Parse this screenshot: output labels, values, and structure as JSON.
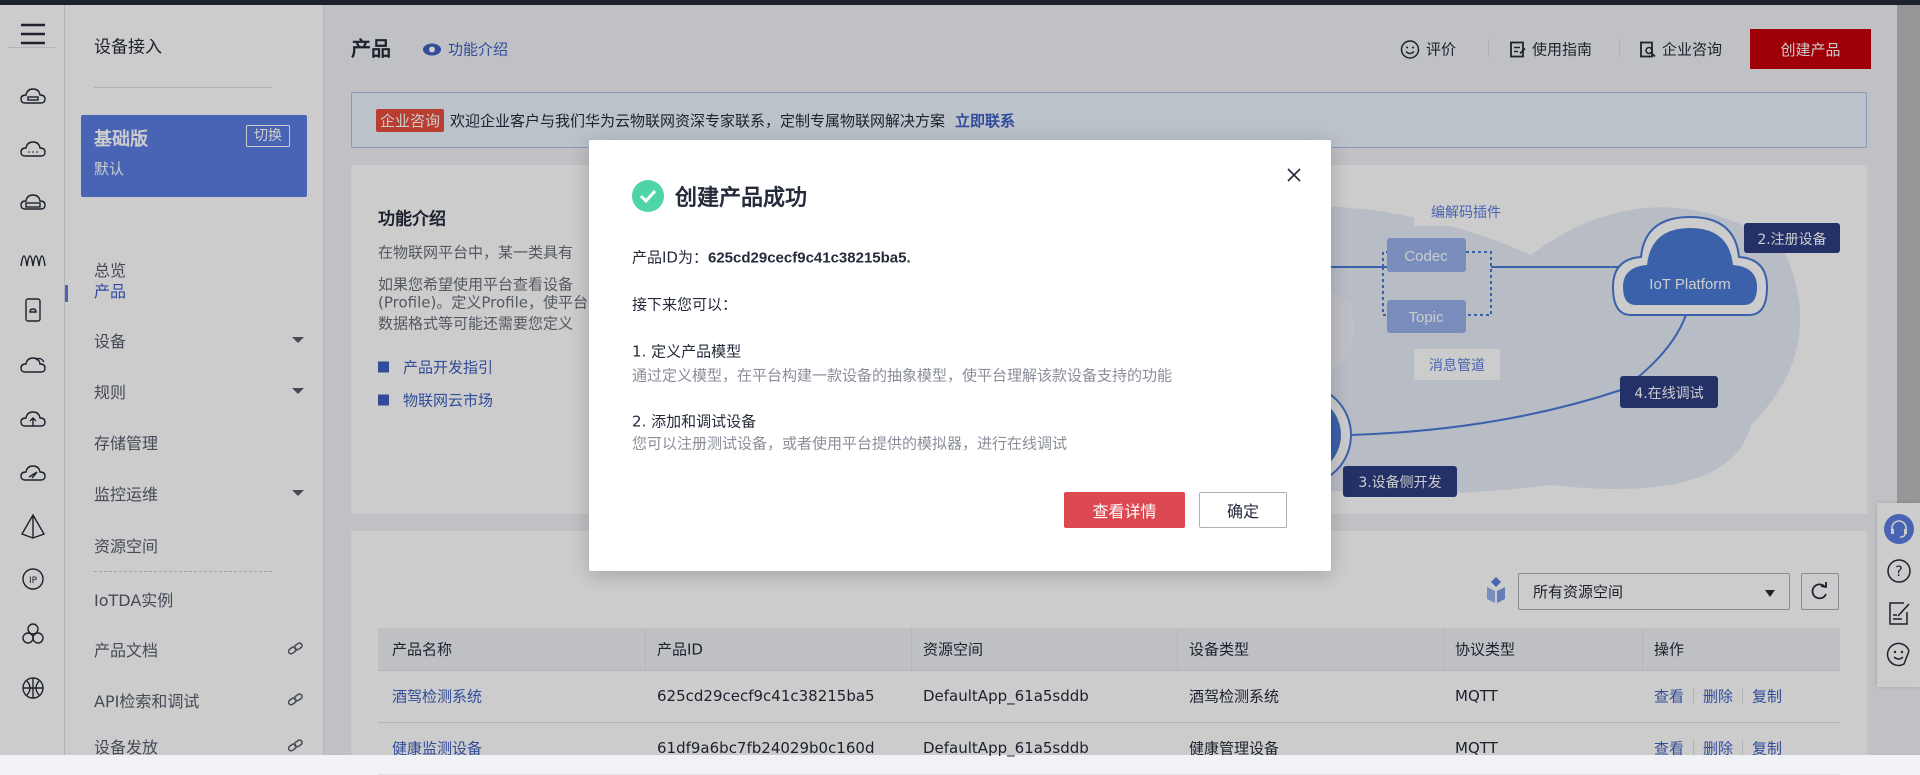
{
  "colors": {
    "accent": "#5c7de1",
    "primary_red": "#c7000b",
    "link": "#3d5fc2",
    "success": "#4fd4a6"
  },
  "rail": {
    "icons": [
      "menu-icon",
      "cloud-device-icon",
      "cloud-dots-icon",
      "cloud-storage-icon",
      "wave-icon",
      "phone-cloud-icon",
      "cloud-icon",
      "cloud-upload-icon",
      "cloud-send-icon",
      "pyramid-icon",
      "ip-icon",
      "hexagon-cluster-icon",
      "globe-icon"
    ]
  },
  "sidebar": {
    "title": "设备接入",
    "edition": {
      "name": "基础版",
      "sub": "默认",
      "switch_label": "切换"
    },
    "items": [
      {
        "label": "总览"
      },
      {
        "label": "产品",
        "active": true
      },
      {
        "label": "设备",
        "expandable": true
      },
      {
        "label": "规则",
        "expandable": true
      },
      {
        "label": "存储管理"
      },
      {
        "label": "监控运维",
        "expandable": true
      },
      {
        "label": "资源空间"
      },
      {
        "label": "IoTDA实例"
      },
      {
        "label": "产品文档",
        "external": true
      },
      {
        "label": "API检索和调试",
        "external": true
      },
      {
        "label": "设备发放",
        "external": true
      }
    ]
  },
  "header": {
    "title": "产品",
    "intro_link": "功能介绍",
    "rate": "评价",
    "guide": "使用指南",
    "consult": "企业咨询",
    "create": "创建产品"
  },
  "banner": {
    "tag": "企业咨询",
    "text": "欢迎企业客户与我们华为云物联网资深专家联系，定制专属物联网解决方案",
    "link": "立即联系"
  },
  "feature": {
    "title": "功能介绍",
    "lines": [
      "在物联网平台中，某一类具有",
      "如果您希望使用平台查看设备",
      "(Profile)。定义Profile，使平台",
      "数据格式等可能还需要您定义"
    ],
    "links": [
      "产品开发指引",
      "物联网云市场"
    ],
    "diagram": {
      "codec_label": "编解码插件",
      "codec": "Codec",
      "topic": "Topic",
      "topic_label": "消息管道",
      "platform": "IoT Platform",
      "step2": "2.注册设备",
      "step3": "3.设备侧开发",
      "step4": "4.在线调试"
    }
  },
  "table": {
    "resource_select": "所有资源空间",
    "columns": [
      "产品名称",
      "产品ID",
      "资源空间",
      "设备类型",
      "协议类型",
      "操作"
    ],
    "rows": [
      {
        "name": "酒驾检测系统",
        "id": "625cd29cecf9c41c38215ba5",
        "space": "DefaultApp_61a5sddb",
        "type": "酒驾检测系统",
        "protocol": "MQTT",
        "ops": [
          "查看",
          "删除",
          "复制"
        ]
      },
      {
        "name": "健康监测设备",
        "id": "61df9a6bc7fb24029b0c160d",
        "space": "DefaultApp_61a5sddb",
        "type": "健康管理设备",
        "protocol": "MQTT",
        "ops": [
          "查看",
          "删除",
          "复制"
        ]
      }
    ]
  },
  "float_tools": [
    "headset-icon",
    "help-icon",
    "feedback-edit-icon",
    "smile-icon"
  ],
  "modal": {
    "title": "创建产品成功",
    "id_label": "产品ID为：",
    "id_value": "625cd29cecf9c41c38215ba5.",
    "next": "接下来您可以：",
    "step1_title": "1. 定义产品模型",
    "step1_desc": "通过定义模型，在平台构建一款设备的抽象模型，使平台理解该款设备支持的功能",
    "step2_title": "2. 添加和调试设备",
    "step2_desc": "您可以注册测试设备，或者使用平台提供的模拟器，进行在线调试",
    "detail_button": "查看详情",
    "ok_button": "确定"
  }
}
